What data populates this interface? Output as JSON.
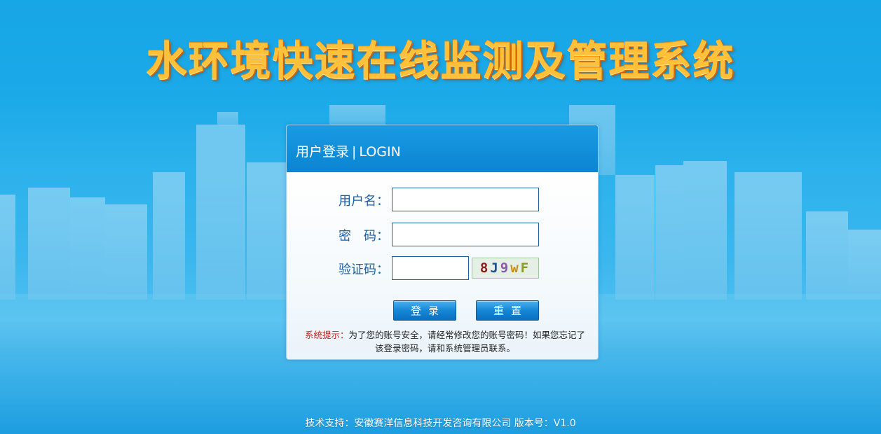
{
  "title": "水环境快速在线监测及管理系统",
  "login_panel": {
    "heading_cn": "用户登录",
    "heading_sep": "|",
    "heading_en": "LOGIN",
    "username_label": "用户名：",
    "password_label": "密　码：",
    "captcha_label": "验证码：",
    "username_value": "",
    "password_value": "",
    "captcha_value": "",
    "captcha_chars": [
      "8",
      "J",
      "9",
      "w",
      "F"
    ],
    "login_button": "登录",
    "reset_button": "重置",
    "tip_label": "系统提示：",
    "tip_text": "为了您的账号安全，请经常修改您的账号密码！如果您忘记了该登录密码，请和系统管理员联系。"
  },
  "footer": "技术支持：安徽赛洋信息科技开发咨询有限公司 版本号：V1.0",
  "colors": {
    "background": "#1ba9e8",
    "title": "#ffc13a",
    "panel_header": "#0b84d1",
    "label": "#1b5ea8",
    "tip_label": "#c8211e"
  }
}
